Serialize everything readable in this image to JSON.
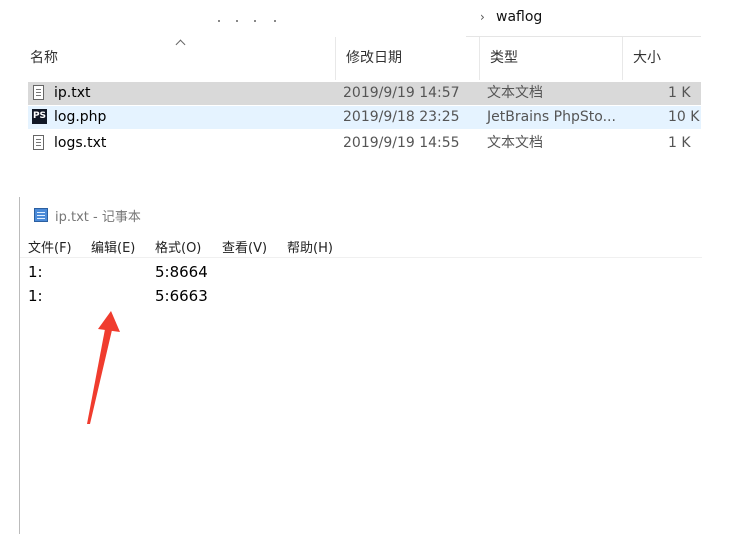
{
  "breadcrumb": {
    "separator": "›",
    "current": "waflog"
  },
  "explorer": {
    "columns": {
      "name": "名称",
      "date": "修改日期",
      "type": "类型",
      "size": "大小"
    },
    "sort_indicator": "ascending",
    "files": [
      {
        "icon": "text-file-icon",
        "name": "ip.txt",
        "date": "2019/9/19 14:57",
        "type": "文本文档",
        "size": "1 K",
        "state": "selected"
      },
      {
        "icon": "phpstorm-icon",
        "name": "log.php",
        "date": "2019/9/18 23:25",
        "type": "JetBrains PhpSto...",
        "size": "10 K",
        "state": "hover"
      },
      {
        "icon": "text-file-icon",
        "name": "logs.txt",
        "date": "2019/9/19 14:55",
        "type": "文本文档",
        "size": "1 K",
        "state": "normal"
      }
    ]
  },
  "notepad": {
    "title": "ip.txt - 记事本",
    "menu": [
      "文件(F)",
      "编辑(E)",
      "格式(O)",
      "查看(V)",
      "帮助(H)"
    ],
    "lines": [
      {
        "start": "1:",
        "end": "5:8664"
      },
      {
        "start": "1:",
        "end": "5:6663"
      }
    ],
    "annotation": {
      "type": "arrow",
      "color": "#f03c2e"
    }
  },
  "colors": {
    "selected_row": "#d9d9d9",
    "hover_row": "#e5f3ff",
    "ps_icon_bg": "#101726",
    "arrow": "#f03c2e"
  }
}
